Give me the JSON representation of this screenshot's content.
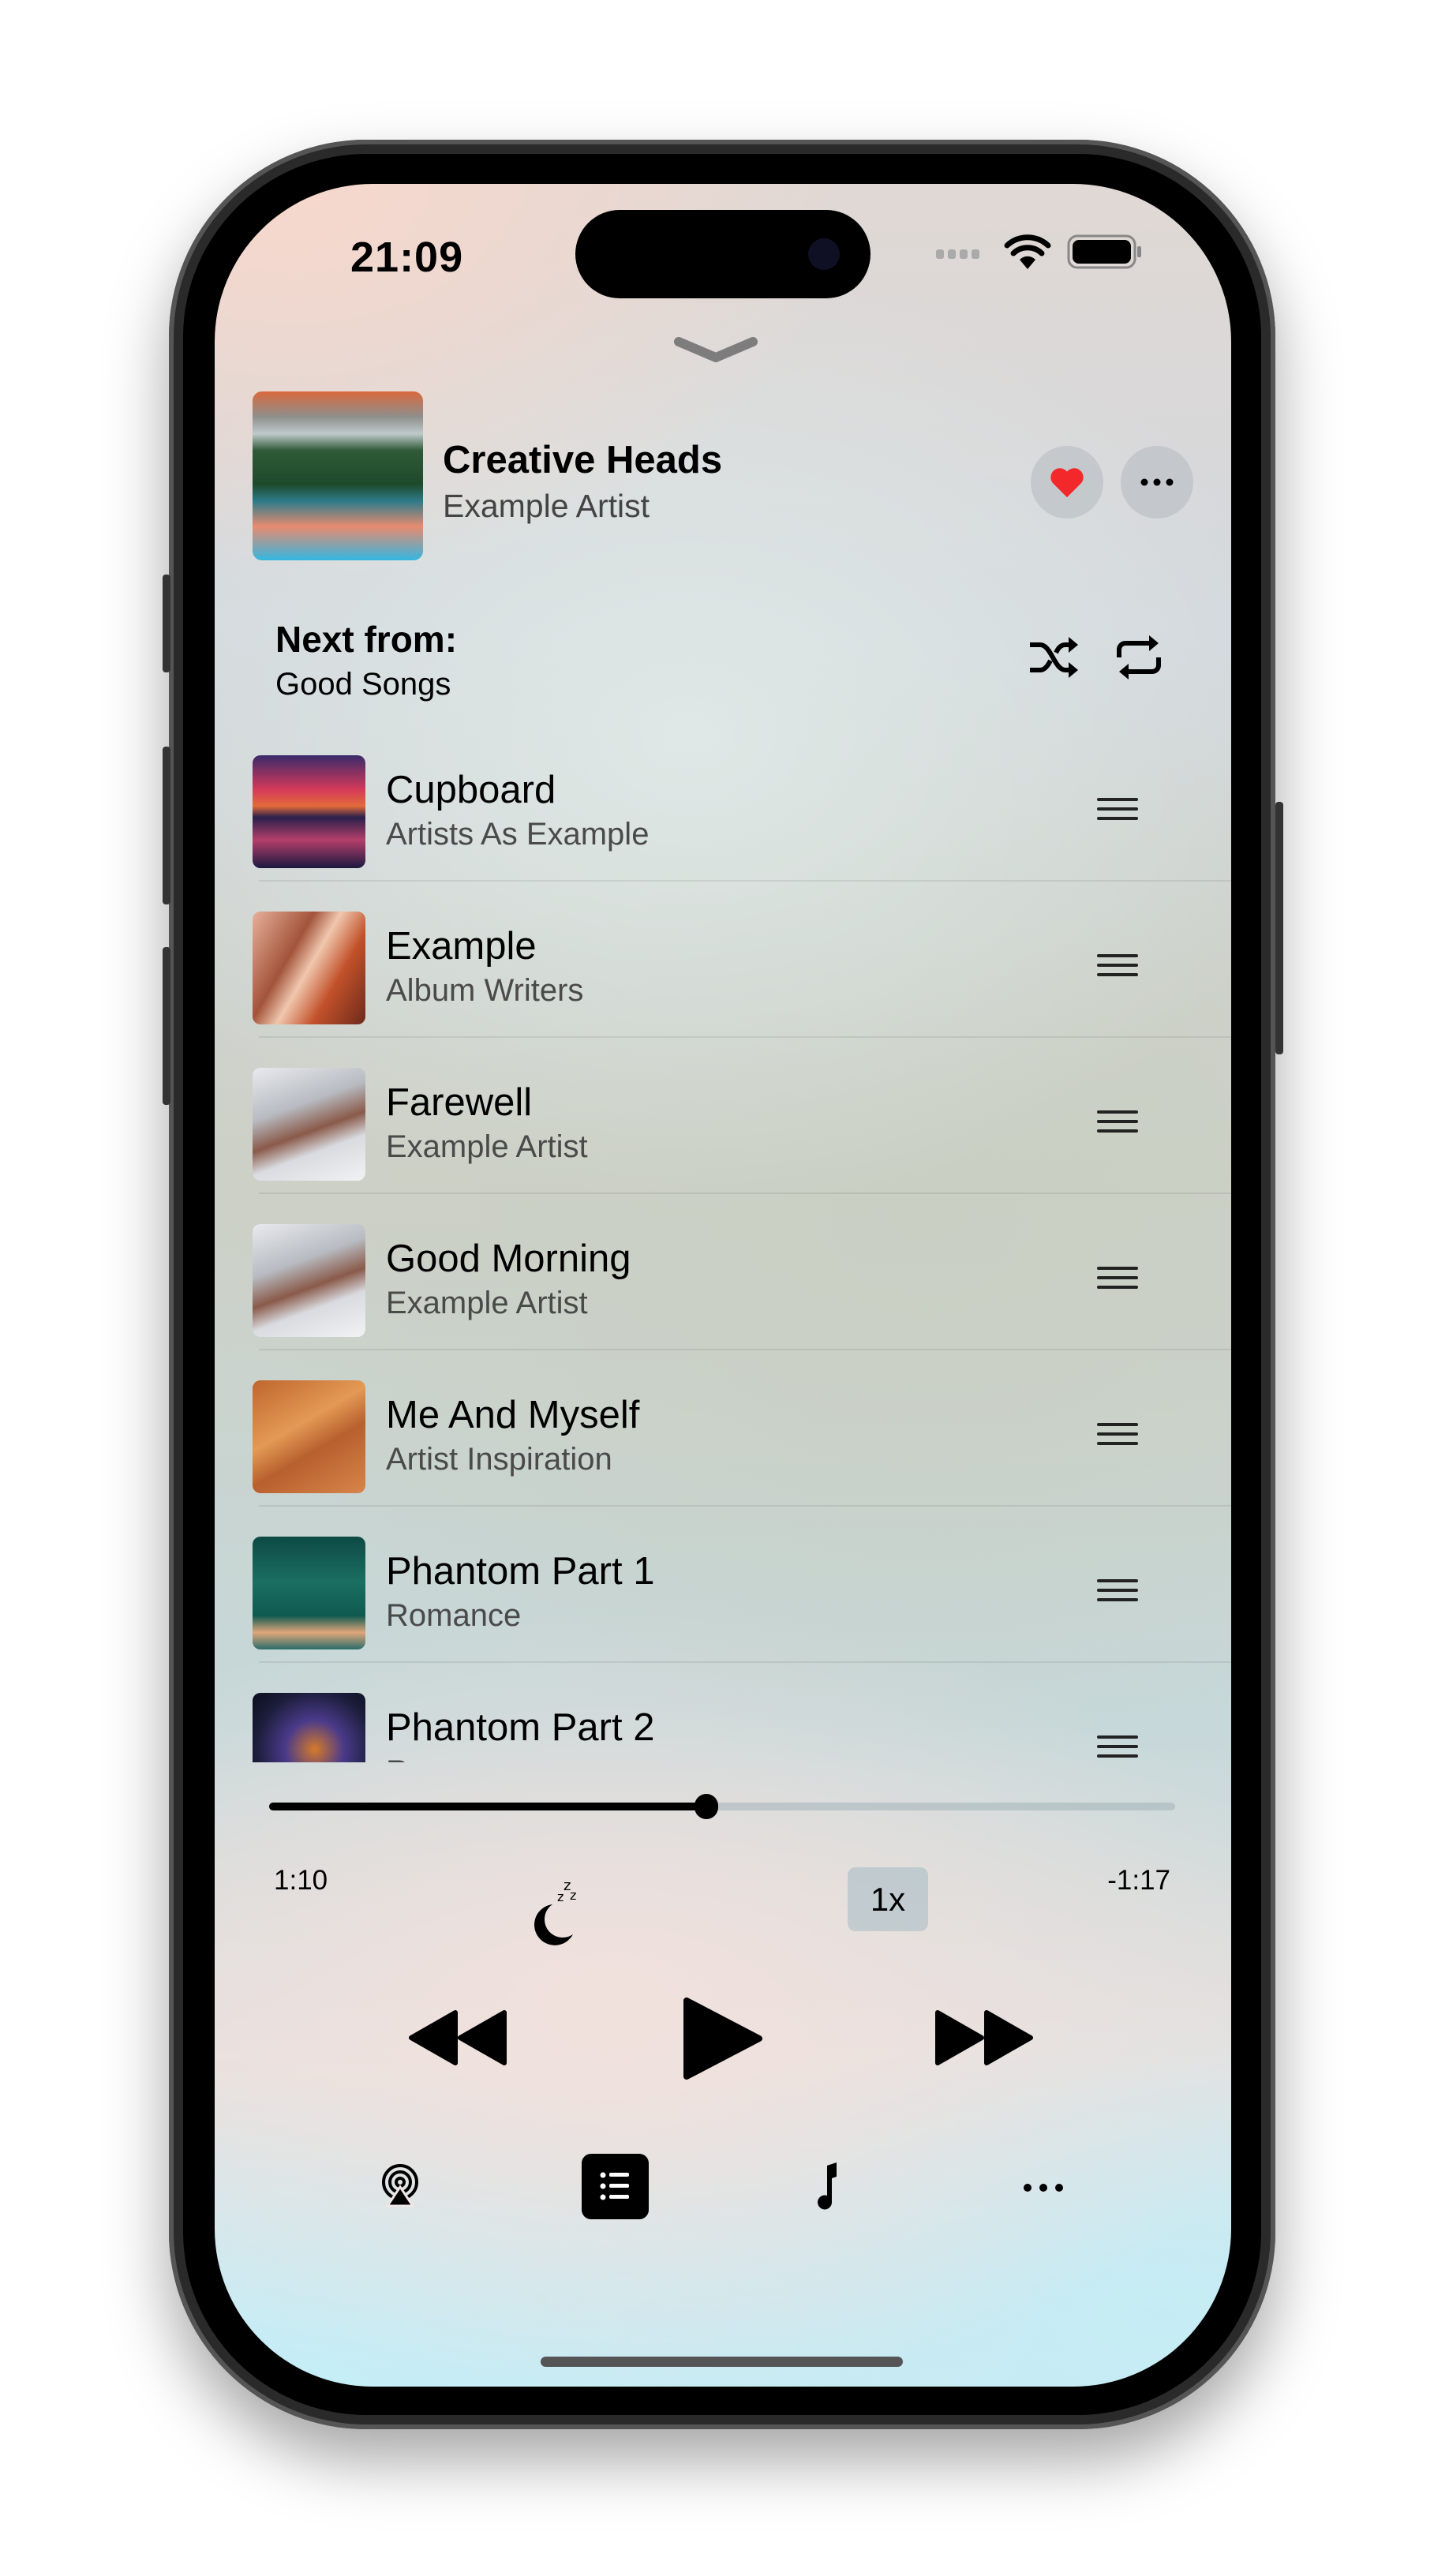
{
  "status_bar": {
    "time": "21:09",
    "wifi_icon": "wifi-icon",
    "battery_icon": "battery-icon"
  },
  "now_playing": {
    "title": "Creative Heads",
    "artist": "Example Artist",
    "favorited": true,
    "heart_color": "#f2282a"
  },
  "queue": {
    "next_label": "Next from:",
    "source": "Good Songs",
    "items": [
      {
        "title": "Cupboard",
        "artist": "Artists As Example"
      },
      {
        "title": "Example",
        "artist": "Album Writers"
      },
      {
        "title": "Farewell",
        "artist": "Example Artist"
      },
      {
        "title": "Good Morning",
        "artist": "Example Artist"
      },
      {
        "title": "Me And Myself",
        "artist": "Artist Inspiration"
      },
      {
        "title": "Phantom Part 1",
        "artist": "Romance"
      },
      {
        "title": "Phantom Part 2",
        "artist": "Romance"
      }
    ]
  },
  "playback": {
    "elapsed": "1:10",
    "remaining": "-1:17",
    "progress": 0.483,
    "speed": "1x",
    "state": "paused"
  }
}
